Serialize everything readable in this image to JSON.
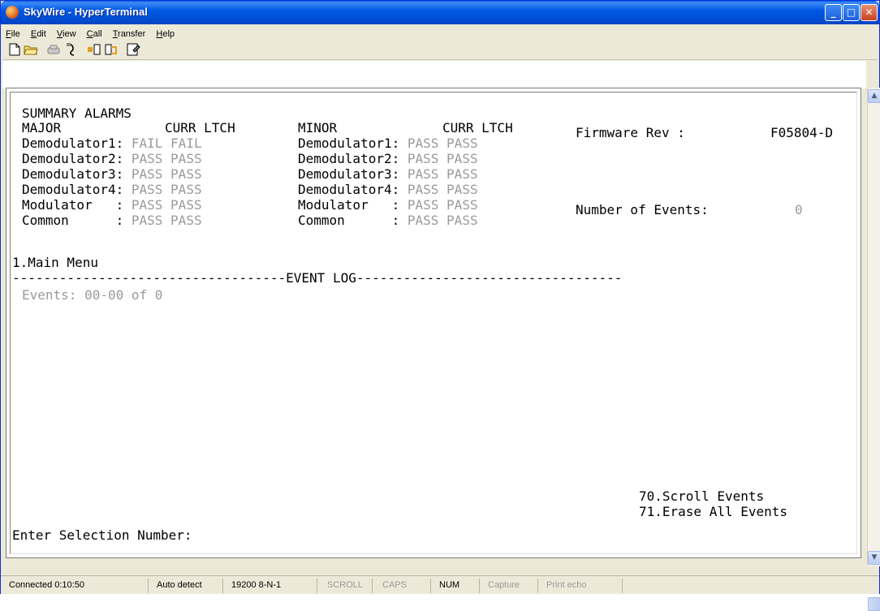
{
  "window": {
    "title": "SkyWire - HyperTerminal"
  },
  "menu": [
    {
      "u": "F",
      "rest": "ile"
    },
    {
      "u": "E",
      "rest": "dit"
    },
    {
      "u": "V",
      "rest": "iew"
    },
    {
      "u": "C",
      "rest": "all"
    },
    {
      "u": "T",
      "rest": "ransfer"
    },
    {
      "u": "H",
      "rest": "elp"
    }
  ],
  "toolbar": [
    "new-icon",
    "open-icon",
    "connect-icon",
    "disconnect-icon",
    "send-icon",
    "receive-icon",
    "properties-icon"
  ],
  "terminal": {
    "header": "SUMMARY ALARMS",
    "major_label": "MAJOR",
    "minor_label": "MINOR",
    "curr_ltch": "CURR LTCH",
    "firmware_label": "Firmware Rev :",
    "firmware_value": "F05804-D",
    "events_label": "Number of Events:",
    "events_value": "0",
    "major_rows": [
      {
        "name": "Demodulator1:",
        "curr": "FAIL",
        "ltch": "FAIL"
      },
      {
        "name": "Demodulator2:",
        "curr": "PASS",
        "ltch": "PASS"
      },
      {
        "name": "Demodulator3:",
        "curr": "PASS",
        "ltch": "PASS"
      },
      {
        "name": "Demodulator4:",
        "curr": "PASS",
        "ltch": "PASS"
      },
      {
        "name": "Modulator   :",
        "curr": "PASS",
        "ltch": "PASS"
      },
      {
        "name": "Common      :",
        "curr": "PASS",
        "ltch": "PASS"
      }
    ],
    "minor_rows": [
      {
        "name": "Demodulator1:",
        "curr": "PASS",
        "ltch": "PASS"
      },
      {
        "name": "Demodulator2:",
        "curr": "PASS",
        "ltch": "PASS"
      },
      {
        "name": "Demodulator3:",
        "curr": "PASS",
        "ltch": "PASS"
      },
      {
        "name": "Demodulator4:",
        "curr": "PASS",
        "ltch": "PASS"
      },
      {
        "name": "Modulator   :",
        "curr": "PASS",
        "ltch": "PASS"
      },
      {
        "name": "Common      :",
        "curr": "PASS",
        "ltch": "PASS"
      }
    ],
    "main_menu": "1.Main Menu",
    "divider": "-----------------------------------EVENT LOG----------------------------------",
    "events_range": "Events: 00-00 of 0",
    "option_70": "70.Scroll Events",
    "option_71": "71.Erase All Events",
    "prompt": "Enter Selection Number:"
  },
  "status": {
    "connected": "Connected 0:10:50",
    "detect": "Auto detect",
    "baud": "19200 8-N-1",
    "scroll": "SCROLL",
    "caps": "CAPS",
    "num": "NUM",
    "capture": "Capture",
    "echo": "Print echo"
  }
}
